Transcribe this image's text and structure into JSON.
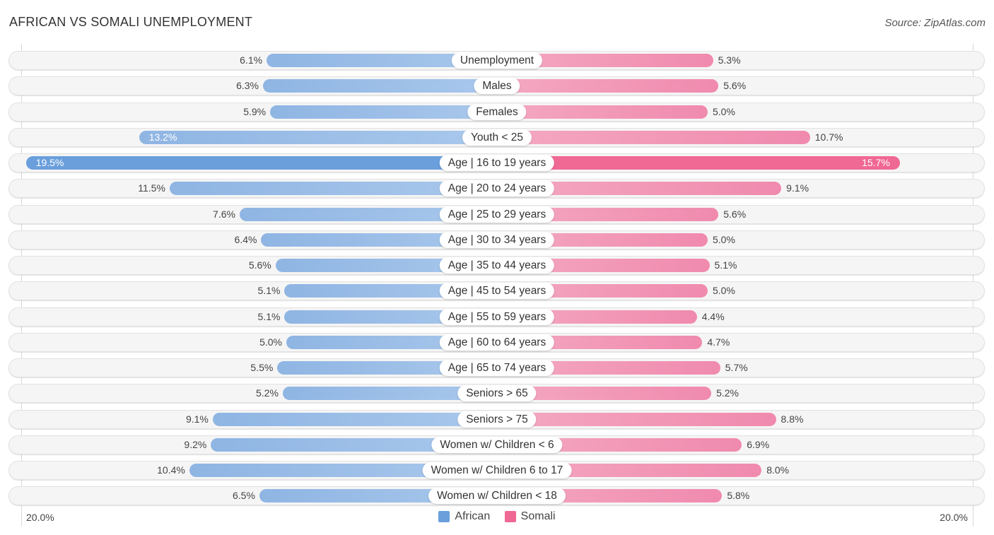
{
  "title": "AFRICAN VS SOMALI UNEMPLOYMENT",
  "source": "Source: ZipAtlas.com",
  "colors": {
    "african": "#6a9fdc",
    "somali": "#f06894"
  },
  "chart_data": {
    "type": "bar",
    "orientation": "horizontal-diverging",
    "title": "AFRICAN VS SOMALI UNEMPLOYMENT",
    "categories": [
      "Unemployment",
      "Males",
      "Females",
      "Youth < 25",
      "Age | 16 to 19 years",
      "Age | 20 to 24 years",
      "Age | 25 to 29 years",
      "Age | 30 to 34 years",
      "Age | 35 to 44 years",
      "Age | 45 to 54 years",
      "Age | 55 to 59 years",
      "Age | 60 to 64 years",
      "Age | 65 to 74 years",
      "Seniors > 65",
      "Seniors > 75",
      "Women w/ Children < 6",
      "Women w/ Children 6 to 17",
      "Women w/ Children < 18"
    ],
    "series": [
      {
        "name": "African",
        "side": "left",
        "values": [
          6.1,
          6.3,
          5.9,
          13.2,
          19.5,
          11.5,
          7.6,
          6.4,
          5.6,
          5.1,
          5.1,
          5.0,
          5.5,
          5.2,
          9.1,
          9.2,
          10.4,
          6.5
        ],
        "labels": [
          "6.1%",
          "6.3%",
          "5.9%",
          "13.2%",
          "19.5%",
          "11.5%",
          "7.6%",
          "6.4%",
          "5.6%",
          "5.1%",
          "5.1%",
          "5.0%",
          "5.5%",
          "5.2%",
          "9.1%",
          "9.2%",
          "10.4%",
          "6.5%"
        ]
      },
      {
        "name": "Somali",
        "side": "right",
        "values": [
          5.3,
          5.6,
          5.0,
          10.7,
          15.7,
          9.1,
          5.6,
          5.0,
          5.1,
          5.0,
          4.4,
          4.7,
          5.7,
          5.2,
          8.8,
          6.9,
          8.0,
          5.8
        ],
        "labels": [
          "5.3%",
          "5.6%",
          "5.0%",
          "10.7%",
          "15.7%",
          "9.1%",
          "5.6%",
          "5.0%",
          "5.1%",
          "5.0%",
          "4.4%",
          "4.7%",
          "5.7%",
          "5.2%",
          "8.8%",
          "6.9%",
          "8.0%",
          "5.8%"
        ]
      }
    ],
    "axis": {
      "max": 20.0,
      "left_label": "20.0%",
      "right_label": "20.0%"
    },
    "legend": {
      "position": "bottom-center",
      "items": [
        "African",
        "Somali"
      ]
    },
    "unit": "%"
  }
}
